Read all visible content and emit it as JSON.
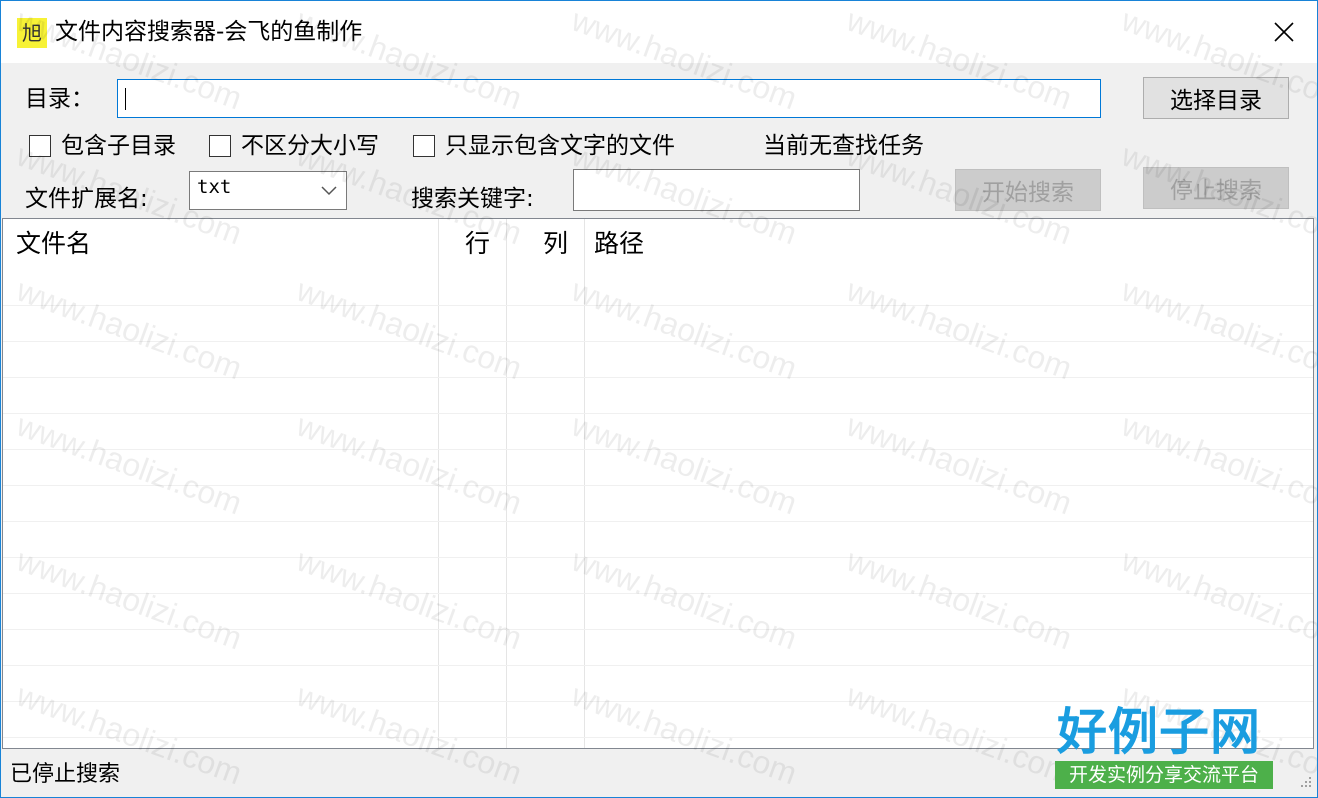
{
  "window": {
    "icon_glyph": "旭",
    "title": "文件内容搜索器-会飞的鱼制作"
  },
  "form": {
    "dir_label": "目录：",
    "dir_value": "",
    "choose_dir_button": "选择目录",
    "checkbox_subdir": {
      "label": "包含子目录",
      "checked": false
    },
    "checkbox_ignore_case": {
      "label": "不区分大小写",
      "checked": false
    },
    "checkbox_only_matching": {
      "label": "只显示包含文字的文件",
      "checked": false
    },
    "task_status": "当前无查找任务",
    "ext_label": "文件扩展名:",
    "ext_selected": "txt",
    "keyword_label": "搜索关键字:",
    "keyword_value": "",
    "start_button": "开始搜索",
    "stop_button": "停止搜索"
  },
  "table": {
    "columns": [
      "文件名",
      "行",
      "列",
      "路径"
    ],
    "rows": []
  },
  "status_bar": {
    "text": "已停止搜索"
  },
  "watermark": {
    "text": "www.haolizi.com",
    "logo_main": "好例子网",
    "logo_sub": "开发实例分享交流平台"
  },
  "colors": {
    "accent": "#0078d7",
    "window_border": "#1883d7",
    "app_icon_bg": "#f7f236",
    "logo_blue": "#1a9de0",
    "logo_green": "#4db04a"
  }
}
